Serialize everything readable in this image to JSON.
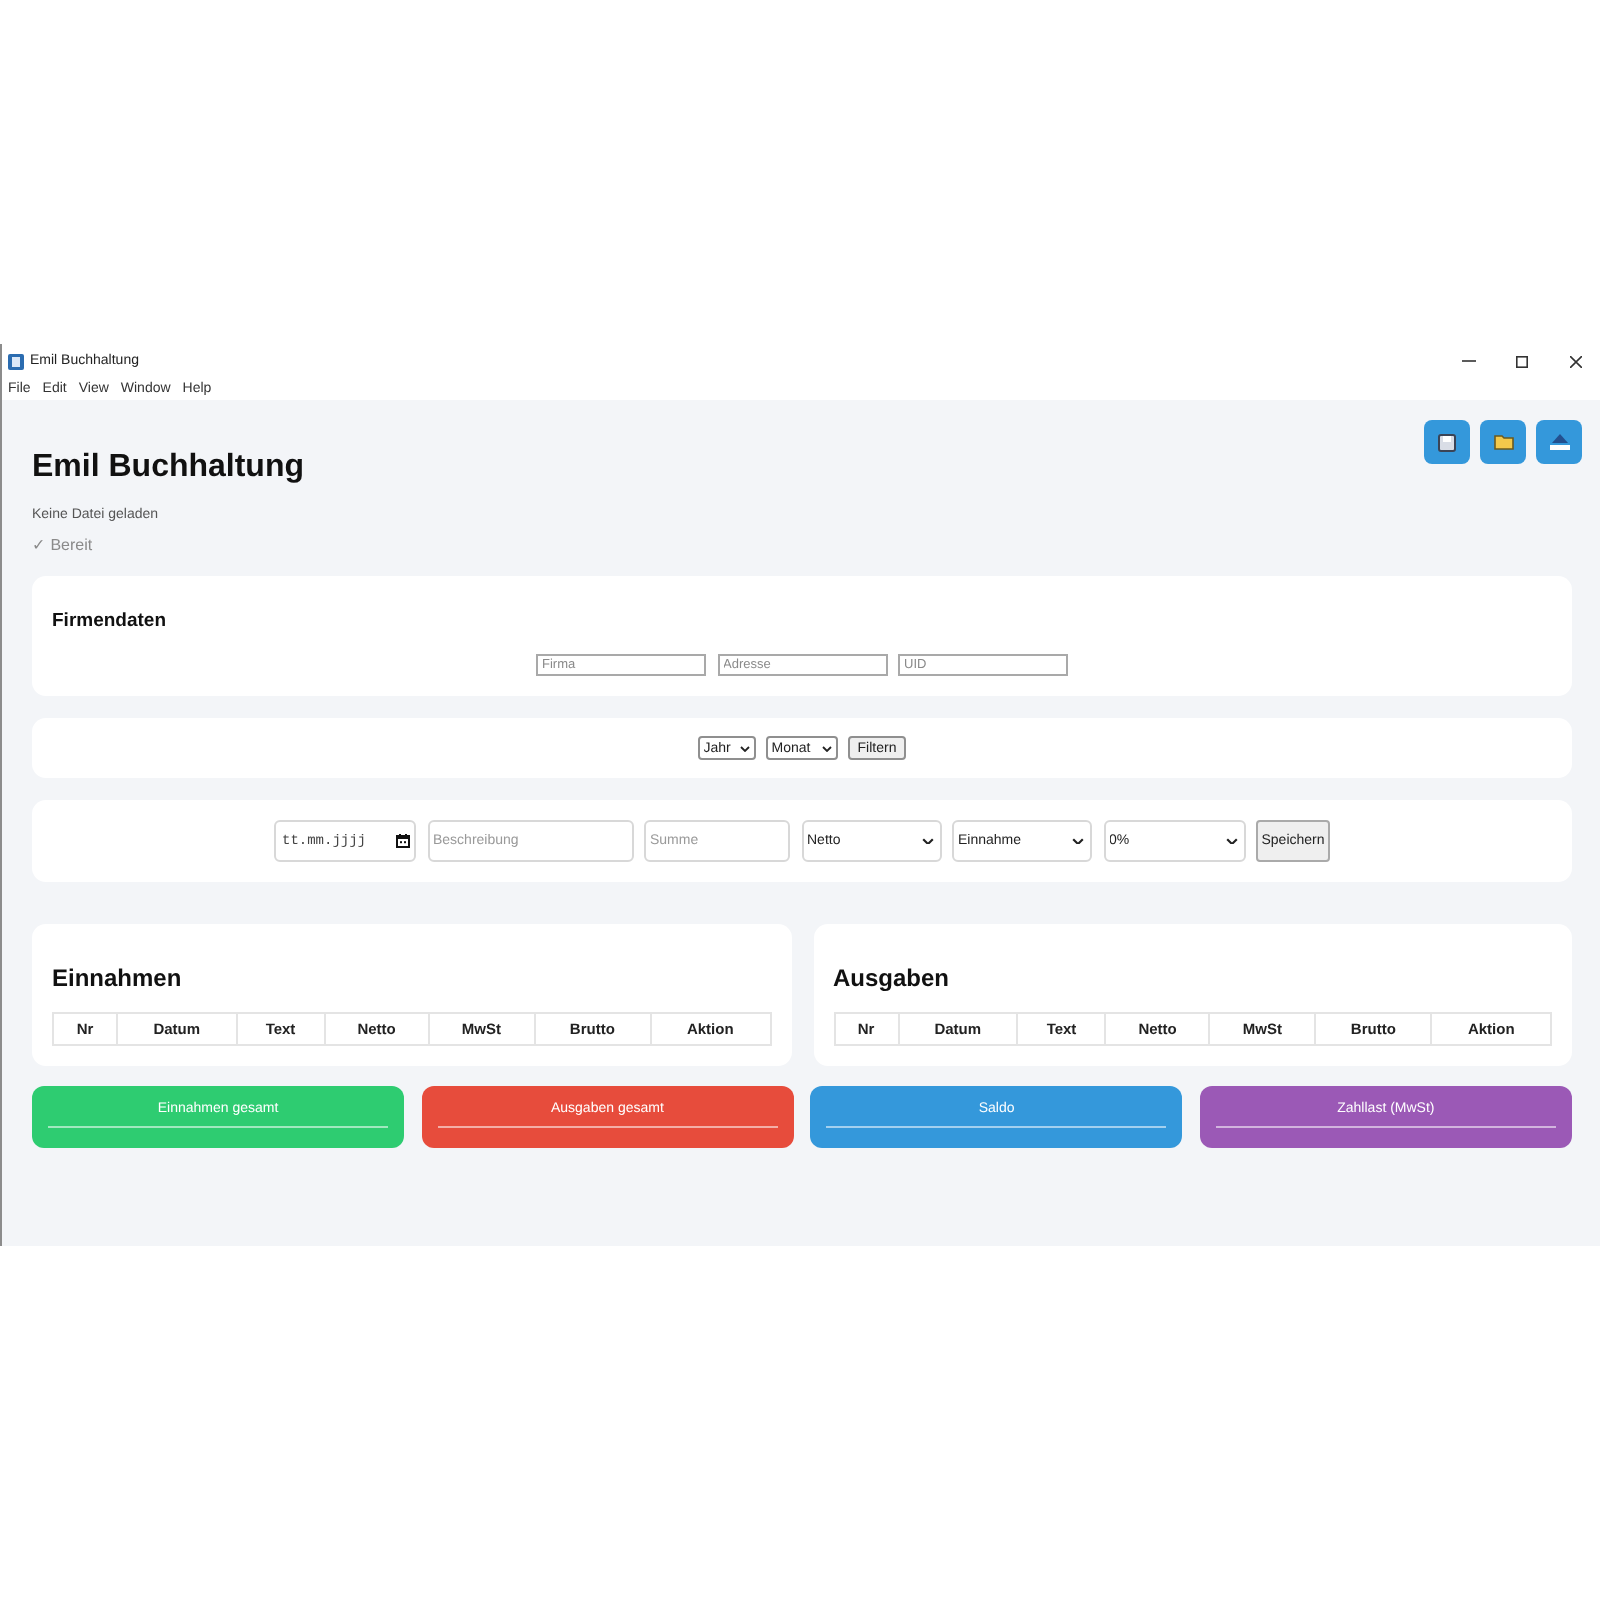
{
  "window": {
    "title": "Emil Buchhaltung"
  },
  "menu": [
    "File",
    "Edit",
    "View",
    "Window",
    "Help"
  ],
  "header": {
    "title": "Emil Buchhaltung",
    "file_status": "Keine Datei geladen",
    "status": "✓ Bereit"
  },
  "company": {
    "title": "Firmendaten",
    "fields": [
      {
        "placeholder": "Firma"
      },
      {
        "placeholder": "Adresse"
      },
      {
        "placeholder": "UID"
      }
    ]
  },
  "filter": {
    "selects": [
      {
        "value": "Jahr"
      },
      {
        "value": "Monat"
      }
    ],
    "button": "Filtern"
  },
  "entry_form": {
    "date": {
      "placeholder": "tt.mm.jjjj"
    },
    "description": {
      "placeholder": "Beschreibung"
    },
    "amount": {
      "placeholder": "Summe"
    },
    "selects": [
      {
        "value": "Netto"
      },
      {
        "value": "Einnahme"
      },
      {
        "value": "0%"
      }
    ],
    "button": "Speichern"
  },
  "tables": [
    {
      "title": "Einnahmen",
      "columns": [
        "Nr",
        "Datum",
        "Text",
        "Netto",
        "MwSt",
        "Brutto",
        "Aktion"
      ]
    },
    {
      "title": "Ausgaben",
      "columns": [
        "Nr",
        "Datum",
        "Text",
        "Netto",
        "MwSt",
        "Brutto",
        "Aktion"
      ]
    }
  ],
  "totals": [
    {
      "label": "Einnahmen gesamt",
      "color": "#2ecc71"
    },
    {
      "label": "Ausgaben gesamt",
      "color": "#e74c3c"
    },
    {
      "label": "Saldo",
      "color": "#3498db"
    },
    {
      "label": "Zahllast (MwSt)",
      "color": "#9b59b6"
    }
  ]
}
